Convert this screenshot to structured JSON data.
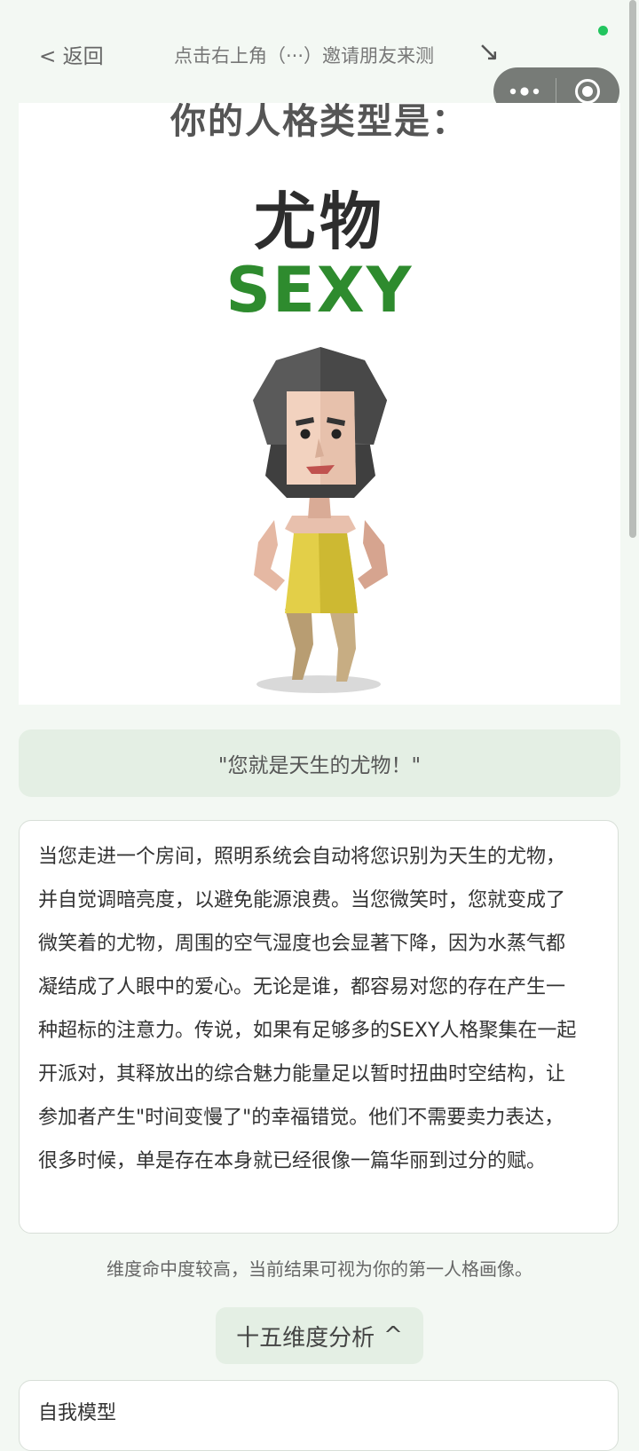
{
  "nav": {
    "back_label": "< 返回",
    "invite_hint": "点击右上角（···）邀请朋友来测",
    "hint_arrow": "↘"
  },
  "capsule": {
    "more_icon": "more-dots-icon",
    "close_icon": "target-circle-icon"
  },
  "colors": {
    "accent_green": "#2e8b2e",
    "status_dot": "#22c55e",
    "soft_green": "#e4efe4",
    "page_bg": "#f3f8f3"
  },
  "result": {
    "heading": "你的人格类型是：",
    "type_name": "尤物",
    "type_code": "SEXY",
    "quote": "\"您就是天生的尤物！\"",
    "description": "当您走进一个房间，照明系统会自动将您识别为天生的尤物，并自觉调暗亮度，以避免能源浪费。当您微笑时，您就变成了微笑着的尤物，周围的空气湿度也会显著下降，因为水蒸气都凝结成了人眼中的爱心。无论是谁，都容易对您的存在产生一种超标的注意力。传说，如果有足够多的SEXY人格聚集在一起开派对，其释放出的综合魅力能量足以暂时扭曲时空结构，让参加者产生\"时间变慢了\"的幸福错觉。他们不需要卖力表达，很多时候，单是存在本身就已经很像一篇华丽到过分的赋。",
    "hit_note": "维度命中度较高，当前结果可视为你的第一人格画像。"
  },
  "analysis": {
    "button_label": "十五维度分析",
    "chevron": "^"
  },
  "dimension_card": {
    "title": "自我模型"
  }
}
